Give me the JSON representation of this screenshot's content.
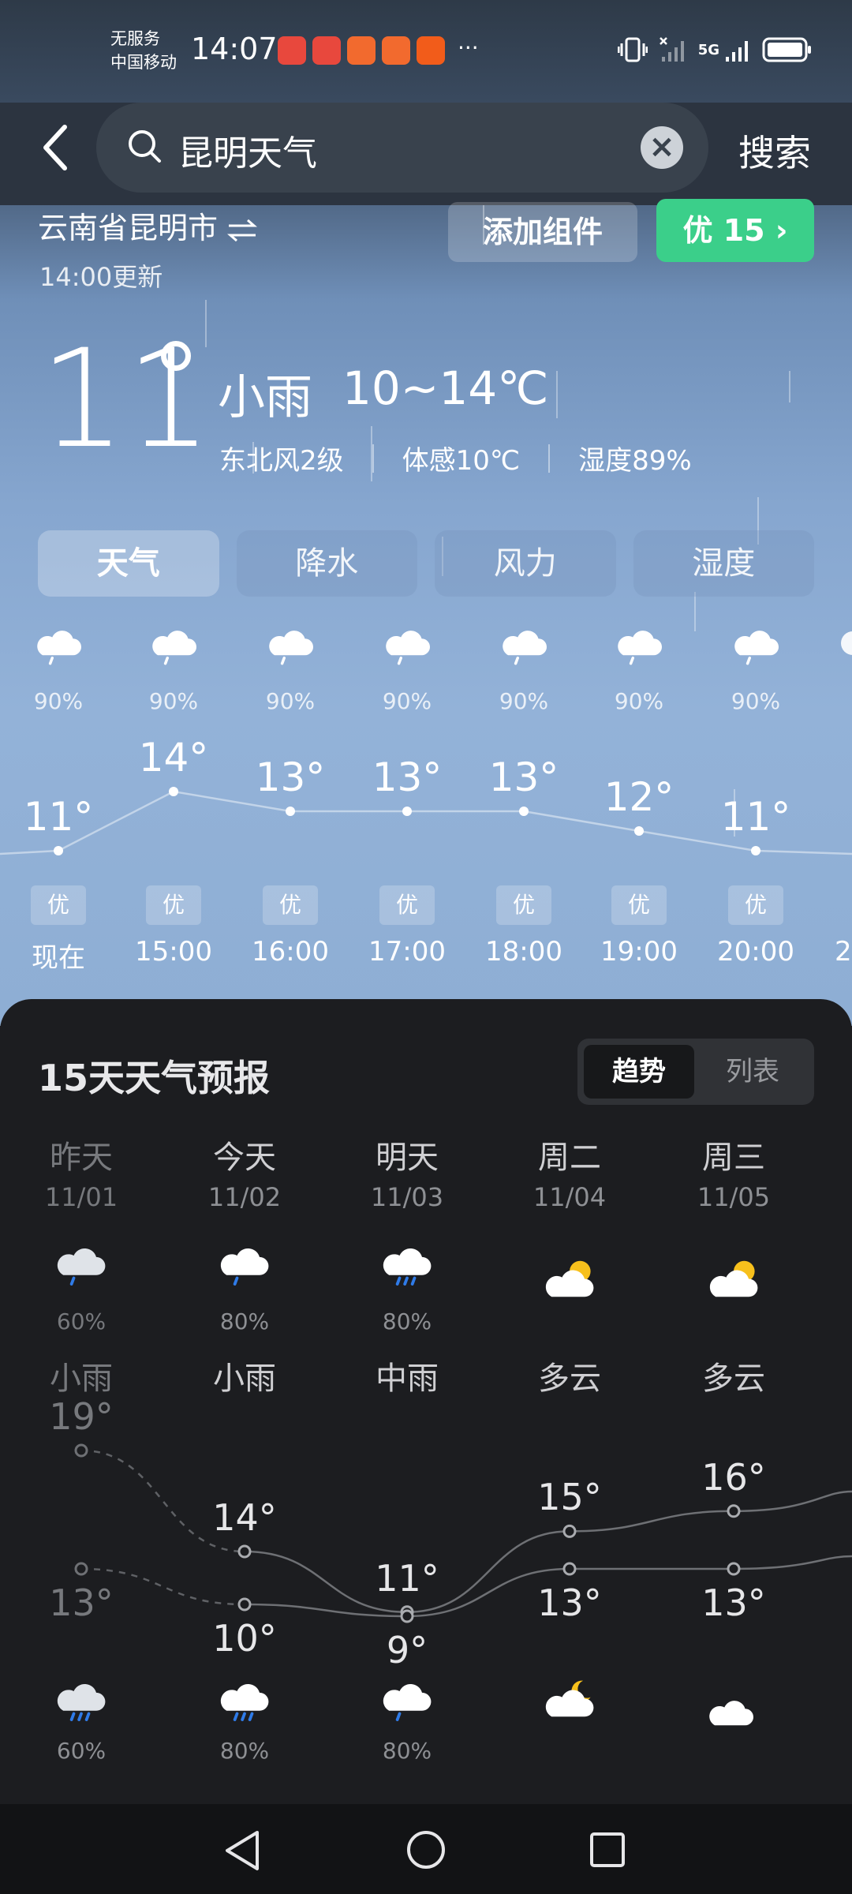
{
  "status_bar": {
    "carrier_line1": "无服务",
    "carrier_line2": "中国移动",
    "time": "14:07",
    "more": "···",
    "network": "5G"
  },
  "search": {
    "back_icon": "back-arrow-icon",
    "query": "昆明天气",
    "clear_icon": "clear-icon",
    "search_label": "搜索"
  },
  "location": {
    "name": "云南省昆明市",
    "updated": "14:00更新",
    "add_widget": "添加组件",
    "aqi_label": "优 15 ›"
  },
  "current": {
    "temp": "11",
    "condition": "小雨",
    "range": "10~14℃",
    "wind": "东北风2级",
    "feels_like": "体感10℃",
    "humidity": "湿度89%"
  },
  "tabs": [
    "天气",
    "降水",
    "风力",
    "湿度"
  ],
  "hourly": [
    {
      "time": "现在",
      "pct": "90%",
      "temp": "11°",
      "aqi": "优",
      "t": 11
    },
    {
      "time": "15:00",
      "pct": "90%",
      "temp": "14°",
      "aqi": "优",
      "t": 14
    },
    {
      "time": "16:00",
      "pct": "90%",
      "temp": "13°",
      "aqi": "优",
      "t": 13
    },
    {
      "time": "17:00",
      "pct": "90%",
      "temp": "13°",
      "aqi": "优",
      "t": 13
    },
    {
      "time": "18:00",
      "pct": "90%",
      "temp": "13°",
      "aqi": "优",
      "t": 13
    },
    {
      "time": "19:00",
      "pct": "90%",
      "temp": "12°",
      "aqi": "优",
      "t": 12
    },
    {
      "time": "20:00",
      "pct": "90%",
      "temp": "11°",
      "aqi": "优",
      "t": 11
    }
  ],
  "forecast": {
    "title": "15天天气预报",
    "toggle_on": "趋势",
    "toggle_off": "列表",
    "days": [
      {
        "name": "昨天",
        "date": "11/01",
        "pct": "60%",
        "cond": "小雨",
        "hi": "19°",
        "lo": "13°",
        "hi_v": 19,
        "lo_v": 13,
        "night_pct": "60%",
        "day_icon": "light-rain-icon",
        "night_icon": "light-rain-icon",
        "past": true
      },
      {
        "name": "今天",
        "date": "11/02",
        "pct": "80%",
        "cond": "小雨",
        "hi": "14°",
        "lo": "10°",
        "hi_v": 14,
        "lo_v": 10,
        "night_pct": "80%",
        "day_icon": "light-rain-icon",
        "night_icon": "light-rain-icon",
        "past": false
      },
      {
        "name": "明天",
        "date": "11/03",
        "pct": "80%",
        "cond": "中雨",
        "hi": "11°",
        "lo": "9°",
        "hi_v": 11,
        "lo_v": 9,
        "night_pct": "80%",
        "day_icon": "moderate-rain-icon",
        "night_icon": "light-rain-icon",
        "past": false
      },
      {
        "name": "周二",
        "date": "11/04",
        "pct": "",
        "cond": "多云",
        "hi": "15°",
        "lo": "13°",
        "hi_v": 15,
        "lo_v": 13,
        "night_pct": "",
        "day_icon": "partly-cloudy-day-icon",
        "night_icon": "partly-cloudy-night-icon",
        "past": false
      },
      {
        "name": "周三",
        "date": "11/05",
        "pct": "",
        "cond": "多云",
        "hi": "16°",
        "lo": "13°",
        "hi_v": 16,
        "lo_v": 13,
        "night_pct": "",
        "day_icon": "partly-cloudy-day-icon",
        "night_icon": "cloudy-icon",
        "past": false
      }
    ]
  },
  "nav": {
    "back": "nav-back-icon",
    "home": "nav-home-icon",
    "recents": "nav-recents-icon"
  }
}
